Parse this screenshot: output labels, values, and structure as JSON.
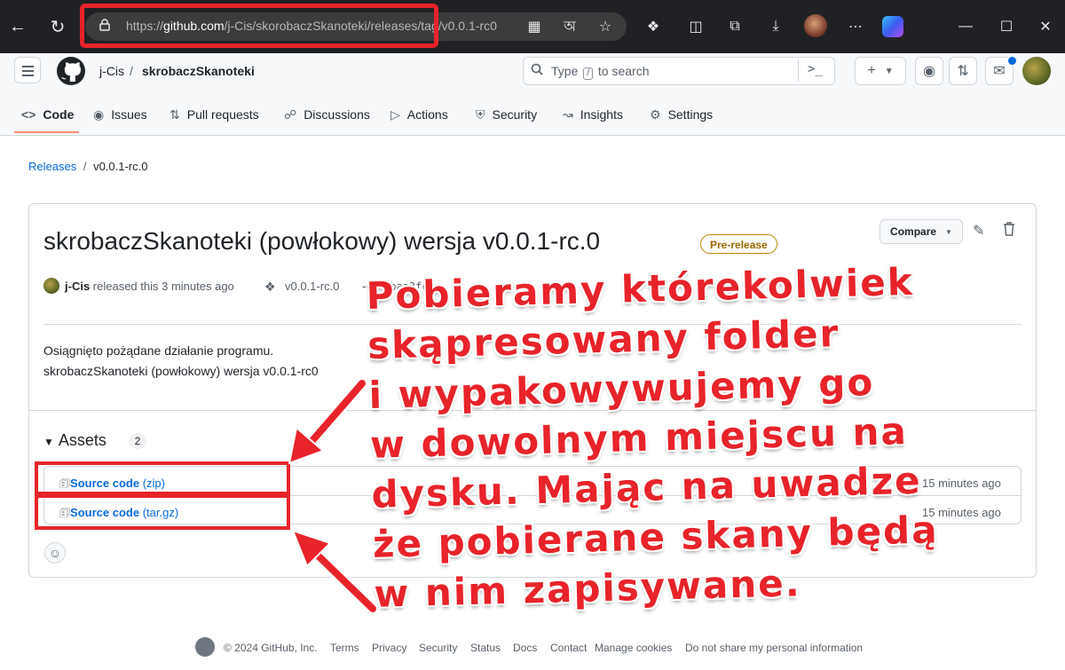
{
  "browser": {
    "url_prefix": "https://",
    "url_host": "github.com",
    "url_path": "/j-Cis/skorobaczSkanoteki/releases/tag/v0.0.1-rc0"
  },
  "repo": {
    "owner": "j-Cis",
    "separator": "/",
    "name": "skrobaczSkanoteki"
  },
  "search": {
    "prefix": "Type",
    "key": "/",
    "suffix": "to search"
  },
  "tabs": [
    {
      "label": "Code",
      "icon": "code-icon"
    },
    {
      "label": "Issues",
      "icon": "issue-icon"
    },
    {
      "label": "Pull requests",
      "icon": "pull-request-icon"
    },
    {
      "label": "Discussions",
      "icon": "discussion-icon"
    },
    {
      "label": "Actions",
      "icon": "play-icon"
    },
    {
      "label": "Security",
      "icon": "shield-icon"
    },
    {
      "label": "Insights",
      "icon": "graph-icon"
    },
    {
      "label": "Settings",
      "icon": "gear-icon"
    }
  ],
  "breadcrumb": {
    "releases": "Releases",
    "sep": "/",
    "current": "v0.0.1-rc.0"
  },
  "release": {
    "title": "skrobaczSkanoteki (powłokowy) wersja v0.0.1-rc.0",
    "badge": "Pre-release",
    "compare_label": "Compare",
    "author": "j-Cis",
    "released_text": "released this 3 minutes ago",
    "tag": "v0.0.1-rc.0",
    "commit": "5baa3fc",
    "body_line1": "Osiągnięto pożądane działanie programu.",
    "body_line2": "skrobaczSkanoteki (powłokowy) wersja v0.0.1-rc0"
  },
  "assets": {
    "title": "Assets",
    "count": "2",
    "items": [
      {
        "name": "Source code",
        "ext": "(zip)",
        "time": "15 minutes ago"
      },
      {
        "name": "Source code",
        "ext": "(tar.gz)",
        "time": "15 minutes ago"
      }
    ]
  },
  "footer": {
    "copyright": "© 2024 GitHub, Inc.",
    "links": [
      "Terms",
      "Privacy",
      "Security",
      "Status",
      "Docs",
      "Contact",
      "Manage cookies",
      "Do not share my personal information"
    ]
  },
  "annotation": {
    "lines": [
      "Pobieramy którekolwiek",
      "skąpresowany folder",
      "i wypakowywujemy go",
      "w dowolnym miejscu na",
      "dysku. Mając na uwadze",
      "że pobierane skany będą",
      "w nim zapisywane."
    ],
    "color": "#e8232a"
  },
  "colors": {
    "accent": "#0969da",
    "tab_underline": "#fd8c73",
    "prerelease": "#9a6700"
  }
}
